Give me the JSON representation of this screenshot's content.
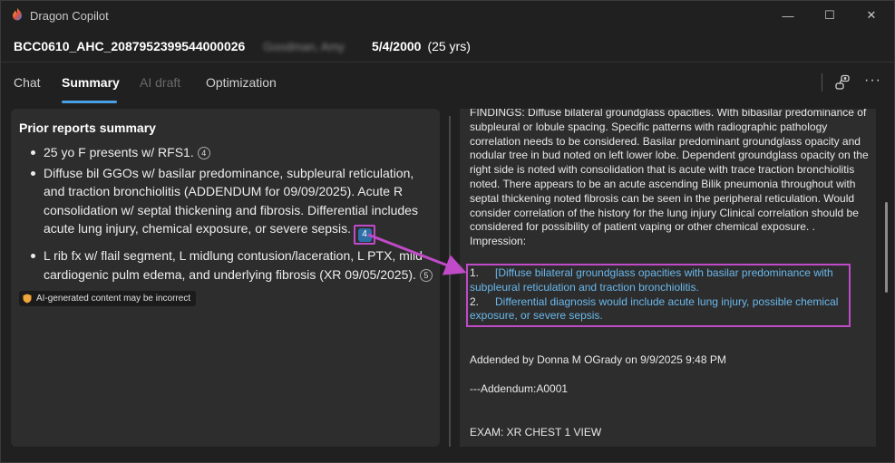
{
  "window": {
    "title": "Dragon Copilot",
    "min_glyph": "—",
    "max_glyph": "☐",
    "close_glyph": "✕"
  },
  "patient": {
    "id": "BCC0610_AHC_2087952399544000026",
    "name": "Goodman, Amy",
    "dob": "5/4/2000",
    "age": "(25 yrs)"
  },
  "tabs": [
    {
      "label": "Chat"
    },
    {
      "label": "Summary"
    },
    {
      "label": "AI draft"
    },
    {
      "label": "Optimization"
    }
  ],
  "more_glyph": "···",
  "summary": {
    "title": "Prior reports summary",
    "items": [
      {
        "text": "25 yo F presents w/ RFS1.",
        "cite": "4"
      },
      {
        "text": "Diffuse bil GGOs w/ basilar predominance, subpleural reticulation, and traction bronchiolitis (ADDENDUM for 09/09/2025). Acute R consolidation w/ septal thickening and fibrosis. Differential includes acute lung injury, chemical exposure, or severe sepsis.",
        "cite": "4"
      },
      {
        "text": "L rib fx w/ flail segment, L midlung contusion/laceration, L PTX, mild cardiogenic pulm edema, and underlying fibrosis (XR 09/05/2025).",
        "cite": "5"
      }
    ],
    "ai_notice": "AI-generated content may be incorrect"
  },
  "report": {
    "findings": "FINDINGS: Diffuse bilateral groundglass opacities. With bibasilar predominance of subpleural or lobule spacing. Specific patterns with radiographic pathology correlation needs to be considered. Basilar predominant groundglass opacity and nodular tree in bud noted on left lower lobe. Dependent groundglass opacity on the right side is noted with consolidation that is acute with trace traction bronchiolitis noted. There appears to be an acute ascending Bilik pneumonia throughout with septal thickening noted fibrosis can be seen in the peripheral reticulation. Would consider correlation of the history for the lung injury Clinical correlation should be considered for possibility of patient vaping or other chemical exposure. .",
    "impression_label": "Impression:",
    "impression_items": [
      {
        "num": "1.",
        "text": "[Diffuse bilateral groundglass opacities with basilar predominance with subpleural reticulation and traction bronchiolitis."
      },
      {
        "num": "2.",
        "text": "Differential diagnosis would include acute lung injury, possible chemical exposure, or severe sepsis."
      }
    ],
    "addended_by": "Addended by Donna M OGrady on 9/9/2025 9:48 PM",
    "addendum_header": "---Addendum:A0001",
    "exam": "EXAM: XR CHEST 1 VIEW"
  },
  "colors": {
    "accent": "#4aa0e6",
    "highlight": "#c04ac8",
    "link_text": "#6ab8ec"
  }
}
